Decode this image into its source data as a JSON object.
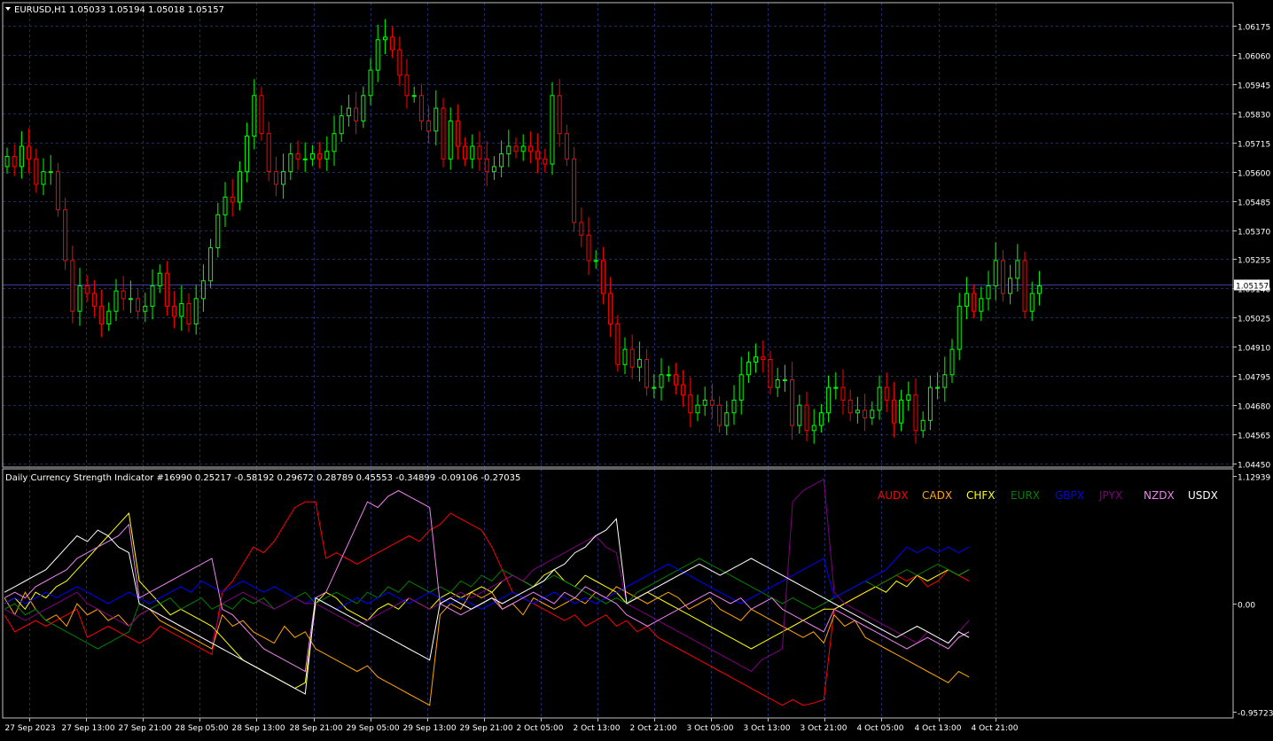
{
  "main_header": {
    "symbol": "EURUSD,H1",
    "ohlc": "1.05033 1.05194 1.05018 1.05157"
  },
  "price_axis": {
    "ticks": [
      "1.06175",
      "1.06060",
      "1.05945",
      "1.05830",
      "1.05715",
      "1.05600",
      "1.05485",
      "1.05370",
      "1.05255",
      "1.05140",
      "1.05025",
      "1.04910",
      "1.04795",
      "1.04680",
      "1.04565",
      "1.04450"
    ],
    "current_price": "1.05157"
  },
  "indicator": {
    "header": "Daily Currency Strength Indicator #16990 0.25217 -0.58192 0.29672 0.28789 0.45553 -0.34899 -0.09106 -0.27035",
    "axis_ticks": [
      "1.12939",
      "0.00",
      "-0.95723"
    ],
    "legend": [
      {
        "label": "AUDX",
        "color": "#ff0000"
      },
      {
        "label": "CADX",
        "color": "#ffa500"
      },
      {
        "label": "CHFX",
        "color": "#ffff00"
      },
      {
        "label": "EURX",
        "color": "#008000"
      },
      {
        "label": "GBPX",
        "color": "#0000ff"
      },
      {
        "label": "JPYX",
        "color": "#800080"
      },
      {
        "label": "NZDX",
        "color": "#ee82ee"
      },
      {
        "label": "USDX",
        "color": "#ffffff"
      }
    ]
  },
  "time_axis": [
    "27 Sep 2023",
    "27 Sep 13:00",
    "27 Sep 21:00",
    "28 Sep 05:00",
    "28 Sep 13:00",
    "28 Sep 21:00",
    "29 Sep 05:00",
    "29 Sep 13:00",
    "29 Sep 21:00",
    "2 Oct 05:00",
    "2 Oct 13:00",
    "2 Oct 21:00",
    "3 Oct 05:00",
    "3 Oct 13:00",
    "3 Oct 21:00",
    "4 Oct 05:00",
    "4 Oct 13:00",
    "4 Oct 21:00"
  ],
  "colors": {
    "bull": "#00ff00",
    "bear": "#ff0000",
    "grid": "#1e2a6e",
    "frame": "#c0c0c0",
    "background": "#000000"
  },
  "chart_data": [
    {
      "type": "candlestick",
      "title": "EURUSD,H1",
      "ylim": [
        1.0445,
        1.0623
      ],
      "close": [
        1.0566,
        1.0562,
        1.057,
        1.0565,
        1.0555,
        1.056,
        1.056,
        1.0545,
        1.0525,
        1.0505,
        1.0515,
        1.0512,
        1.0507,
        1.05,
        1.0505,
        1.0513,
        1.051,
        1.051,
        1.0505,
        1.0507,
        1.0515,
        1.052,
        1.0507,
        1.0503,
        1.0508,
        1.05,
        1.051,
        1.0517,
        1.053,
        1.0543,
        1.055,
        1.0548,
        1.056,
        1.0574,
        1.059,
        1.0575,
        1.056,
        1.0555,
        1.056,
        1.0567,
        1.0565,
        1.0565,
        1.0567,
        1.0565,
        1.0568,
        1.0575,
        1.0582,
        1.0585,
        1.058,
        1.059,
        1.06,
        1.0612,
        1.0613,
        1.0608,
        1.0598,
        1.059,
        1.059,
        1.058,
        1.0576,
        1.0585,
        1.0565,
        1.058,
        1.057,
        1.0565,
        1.057,
        1.0565,
        1.056,
        1.0562,
        1.0567,
        1.057,
        1.0568,
        1.057,
        1.0568,
        1.0565,
        1.0563,
        1.059,
        1.0575,
        1.0565,
        1.054,
        1.0535,
        1.0525,
        1.0525,
        1.0512,
        1.05,
        1.0484,
        1.049,
        1.0483,
        1.0486,
        1.0475,
        1.0475,
        1.048,
        1.048,
        1.0476,
        1.0472,
        1.0465,
        1.0468,
        1.047,
        1.0468,
        1.046,
        1.0465,
        1.047,
        1.048,
        1.0485,
        1.0487,
        1.0486,
        1.0475,
        1.0478,
        1.0478,
        1.046,
        1.0468,
        1.0458,
        1.046,
        1.0465,
        1.0475,
        1.0475,
        1.047,
        1.0465,
        1.0466,
        1.0463,
        1.0466,
        1.0475,
        1.047,
        1.0461,
        1.047,
        1.0472,
        1.0458,
        1.0462,
        1.0475,
        1.0475,
        1.048,
        1.049,
        1.0507,
        1.0512,
        1.0505,
        1.051,
        1.0515,
        1.0525,
        1.0512,
        1.0518,
        1.0525,
        1.0505,
        1.0512,
        1.0515
      ]
    },
    {
      "type": "line",
      "title": "Daily Currency Strength Indicator #16990",
      "ylim": [
        -0.95723,
        1.12939
      ],
      "series": [
        {
          "name": "AUDX",
          "values": [
            -0.1,
            -0.25,
            -0.2,
            -0.15,
            -0.2,
            -0.15,
            -0.1,
            -0.05,
            -0.3,
            -0.25,
            -0.2,
            -0.25,
            -0.3,
            -0.35,
            -0.3,
            -0.2,
            -0.25,
            -0.3,
            -0.35,
            -0.4,
            -0.45,
            0.1,
            0.2,
            0.35,
            0.5,
            0.45,
            0.55,
            0.7,
            0.85,
            0.9,
            0.9,
            0.4,
            0.45,
            0.4,
            0.35,
            0.4,
            0.45,
            0.5,
            0.55,
            0.6,
            0.55,
            0.65,
            0.7,
            0.8,
            0.75,
            0.7,
            0.65,
            0.5,
            0.3,
            0.1,
            0.05,
            0.0,
            -0.05,
            -0.1,
            -0.15,
            -0.1,
            -0.2,
            -0.15,
            -0.1,
            -0.2,
            -0.15,
            -0.25,
            -0.2,
            -0.3,
            -0.35,
            -0.4,
            -0.45,
            -0.5,
            -0.55,
            -0.6,
            -0.65,
            -0.7,
            -0.75,
            -0.8,
            -0.85,
            -0.9,
            -0.85,
            -0.9,
            -0.88,
            -0.85,
            -0.05,
            0.0,
            0.05,
            0.1,
            0.15,
            0.2,
            0.25,
            0.2,
            0.25,
            0.15,
            0.2,
            0.3,
            0.25,
            0.2
          ]
        },
        {
          "name": "CADX",
          "values": [
            0.05,
            -0.1,
            0.1,
            -0.05,
            -0.15,
            -0.1,
            -0.2,
            0.0,
            -0.1,
            -0.05,
            -0.15,
            -0.1,
            -0.2,
            -0.1,
            -0.05,
            -0.15,
            -0.2,
            -0.25,
            -0.3,
            -0.35,
            -0.4,
            -0.1,
            -0.2,
            -0.15,
            -0.25,
            -0.3,
            -0.35,
            -0.2,
            -0.3,
            -0.25,
            -0.4,
            -0.45,
            -0.5,
            -0.55,
            -0.6,
            -0.55,
            -0.65,
            -0.7,
            -0.75,
            -0.8,
            -0.85,
            -0.9,
            -0.1,
            0.0,
            -0.05,
            0.1,
            0.05,
            0.1,
            -0.05,
            0.0,
            -0.1,
            0.05,
            0.0,
            -0.05,
            0.0,
            0.05,
            0.0,
            0.1,
            0.05,
            0.15,
            0.1,
            0.05,
            0.0,
            0.05,
            0.1,
            0.05,
            -0.05,
            0.0,
            0.05,
            -0.05,
            -0.1,
            -0.15,
            -0.05,
            -0.1,
            -0.15,
            -0.2,
            -0.25,
            -0.3,
            -0.25,
            -0.35,
            -0.1,
            -0.2,
            -0.15,
            -0.3,
            -0.35,
            -0.4,
            -0.45,
            -0.5,
            -0.55,
            -0.6,
            -0.65,
            -0.7,
            -0.6,
            -0.65
          ]
        },
        {
          "name": "CHFX",
          "values": [
            0.0,
            0.05,
            -0.05,
            0.1,
            0.05,
            0.15,
            0.2,
            0.3,
            0.4,
            0.5,
            0.6,
            0.7,
            0.8,
            0.2,
            0.1,
            0.0,
            -0.1,
            -0.05,
            -0.1,
            -0.15,
            -0.2,
            -0.3,
            -0.4,
            -0.5,
            -0.55,
            -0.6,
            -0.65,
            -0.7,
            -0.75,
            -0.7,
            0.0,
            0.1,
            0.05,
            -0.05,
            -0.1,
            -0.15,
            -0.05,
            0.0,
            -0.05,
            0.05,
            0.0,
            -0.05,
            0.05,
            0.1,
            0.05,
            0.1,
            0.15,
            0.1,
            0.2,
            0.25,
            0.2,
            0.15,
            0.25,
            0.3,
            0.2,
            0.15,
            0.25,
            0.2,
            0.15,
            0.1,
            0.0,
            0.05,
            0.1,
            0.05,
            0.0,
            -0.05,
            -0.1,
            -0.15,
            -0.2,
            -0.25,
            -0.3,
            -0.35,
            -0.4,
            -0.35,
            -0.3,
            -0.25,
            -0.2,
            -0.15,
            -0.1,
            -0.05,
            -0.05,
            0.0,
            0.05,
            0.1,
            0.15,
            0.1,
            0.2,
            0.15,
            0.25,
            0.2,
            0.25,
            0.3,
            0.25,
            0.3
          ]
        },
        {
          "name": "EURX",
          "values": [
            -0.05,
            0.0,
            -0.1,
            -0.05,
            -0.15,
            -0.2,
            -0.25,
            -0.3,
            -0.35,
            -0.4,
            -0.35,
            -0.3,
            -0.25,
            0.0,
            -0.05,
            0.0,
            0.05,
            -0.05,
            0.0,
            0.05,
            -0.05,
            0.0,
            -0.05,
            0.05,
            0.0,
            0.05,
            -0.05,
            0.0,
            0.05,
            0.1,
            0.0,
            0.05,
            0.1,
            0.05,
            0.0,
            0.1,
            0.05,
            0.15,
            0.1,
            0.2,
            0.15,
            0.1,
            0.15,
            0.1,
            0.2,
            0.15,
            0.25,
            0.2,
            0.3,
            0.25,
            0.2,
            0.15,
            0.2,
            0.25,
            0.2,
            0.15,
            0.1,
            0.05,
            0.0,
            0.05,
            0.0,
            0.1,
            0.15,
            0.2,
            0.25,
            0.3,
            0.35,
            0.4,
            0.35,
            0.3,
            0.25,
            0.2,
            0.15,
            0.1,
            0.05,
            0.0,
            0.05,
            0.0,
            -0.05,
            0.0,
            0.05,
            0.1,
            0.15,
            0.2,
            0.15,
            0.2,
            0.25,
            0.3,
            0.25,
            0.3,
            0.35,
            0.3,
            0.25,
            0.3
          ]
        },
        {
          "name": "GBPX",
          "values": [
            0.0,
            0.05,
            0.0,
            0.05,
            0.1,
            0.05,
            0.1,
            0.15,
            0.1,
            0.05,
            0.0,
            0.05,
            0.1,
            0.05,
            0.0,
            0.05,
            0.1,
            0.15,
            0.1,
            0.2,
            0.15,
            0.1,
            0.15,
            0.2,
            0.15,
            0.1,
            0.15,
            0.1,
            0.05,
            0.0,
            0.05,
            0.0,
            -0.05,
            0.0,
            0.05,
            0.0,
            0.05,
            0.1,
            0.05,
            0.0,
            0.05,
            0.1,
            0.05,
            0.0,
            0.05,
            0.0,
            -0.05,
            0.0,
            0.05,
            0.1,
            0.05,
            0.0,
            0.05,
            0.1,
            0.05,
            0.0,
            0.05,
            0.0,
            0.05,
            0.1,
            0.15,
            0.2,
            0.25,
            0.3,
            0.35,
            0.3,
            0.25,
            0.2,
            0.15,
            0.1,
            0.05,
            0.0,
            0.05,
            0.1,
            0.15,
            0.2,
            0.25,
            0.3,
            0.35,
            0.4,
            0.05,
            0.1,
            0.15,
            0.2,
            0.25,
            0.3,
            0.4,
            0.5,
            0.45,
            0.5,
            0.45,
            0.5,
            0.45,
            0.5
          ]
        },
        {
          "name": "JPYX",
          "values": [
            -0.05,
            -0.1,
            -0.15,
            -0.1,
            -0.05,
            0.0,
            0.05,
            0.1,
            0.0,
            -0.05,
            -0.1,
            -0.15,
            -0.2,
            -0.1,
            -0.05,
            -0.1,
            -0.15,
            -0.2,
            -0.25,
            -0.3,
            -0.35,
            0.0,
            0.05,
            0.1,
            0.05,
            0.0,
            -0.05,
            0.0,
            0.05,
            0.0,
            0.0,
            -0.05,
            -0.1,
            -0.15,
            -0.2,
            -0.15,
            -0.1,
            -0.05,
            0.0,
            0.05,
            0.0,
            -0.05,
            0.0,
            0.05,
            0.1,
            0.05,
            0.1,
            0.15,
            0.2,
            0.25,
            0.2,
            0.3,
            0.35,
            0.4,
            0.45,
            0.5,
            0.55,
            0.6,
            0.5,
            0.45,
            0.0,
            -0.05,
            -0.1,
            -0.15,
            -0.2,
            -0.25,
            -0.3,
            -0.35,
            -0.4,
            -0.45,
            -0.5,
            -0.55,
            -0.6,
            -0.5,
            -0.45,
            -0.4,
            0.9,
            1.0,
            1.05,
            1.1,
            0.1,
            0.0,
            -0.05,
            -0.1,
            -0.15,
            -0.2,
            -0.25,
            -0.3,
            -0.35,
            -0.25,
            -0.3,
            -0.35,
            -0.25,
            -0.15
          ]
        },
        {
          "name": "NZDX",
          "values": [
            0.05,
            0.1,
            0.05,
            0.15,
            0.2,
            0.25,
            0.3,
            0.4,
            0.45,
            0.5,
            0.55,
            0.6,
            0.7,
            0.05,
            0.1,
            0.15,
            0.2,
            0.25,
            0.3,
            0.35,
            0.4,
            -0.05,
            -0.1,
            -0.2,
            -0.3,
            -0.4,
            -0.45,
            -0.5,
            -0.55,
            -0.6,
            0.05,
            0.1,
            0.3,
            0.5,
            0.7,
            0.9,
            0.85,
            0.95,
            1.0,
            0.95,
            0.9,
            0.85,
            0.0,
            -0.05,
            -0.1,
            -0.05,
            0.0,
            0.05,
            -0.05,
            0.0,
            0.05,
            0.1,
            0.05,
            0.0,
            0.1,
            0.05,
            0.15,
            0.1,
            0.05,
            0.0,
            -0.1,
            -0.15,
            -0.2,
            -0.15,
            -0.1,
            -0.05,
            0.0,
            0.05,
            0.1,
            0.05,
            0.0,
            0.05,
            -0.05,
            0.0,
            0.05,
            -0.05,
            -0.1,
            -0.15,
            -0.2,
            -0.25,
            -0.05,
            -0.1,
            -0.15,
            -0.2,
            -0.25,
            -0.3,
            -0.35,
            -0.4,
            -0.35,
            -0.3,
            -0.35,
            -0.4,
            -0.3,
            -0.25
          ]
        },
        {
          "name": "USDX",
          "values": [
            0.1,
            0.15,
            0.2,
            0.25,
            0.3,
            0.4,
            0.5,
            0.6,
            0.55,
            0.65,
            0.6,
            0.5,
            0.45,
            0.0,
            -0.05,
            -0.1,
            -0.15,
            -0.2,
            -0.25,
            -0.3,
            -0.35,
            -0.4,
            -0.45,
            -0.5,
            -0.55,
            -0.6,
            -0.65,
            -0.7,
            -0.75,
            -0.8,
            0.05,
            0.0,
            -0.05,
            -0.1,
            -0.15,
            -0.2,
            -0.25,
            -0.3,
            -0.35,
            -0.4,
            -0.45,
            -0.5,
            0.0,
            0.05,
            0.0,
            -0.05,
            0.0,
            0.05,
            0.0,
            0.05,
            0.1,
            0.15,
            0.2,
            0.3,
            0.35,
            0.45,
            0.5,
            0.6,
            0.65,
            0.75,
            0.0,
            0.05,
            0.1,
            0.15,
            0.2,
            0.25,
            0.3,
            0.35,
            0.3,
            0.25,
            0.3,
            0.35,
            0.4,
            0.35,
            0.3,
            0.25,
            0.2,
            0.15,
            0.1,
            0.05,
            0.0,
            -0.05,
            -0.1,
            -0.15,
            -0.2,
            -0.25,
            -0.3,
            -0.25,
            -0.2,
            -0.25,
            -0.3,
            -0.35,
            -0.25,
            -0.3
          ]
        }
      ]
    }
  ]
}
